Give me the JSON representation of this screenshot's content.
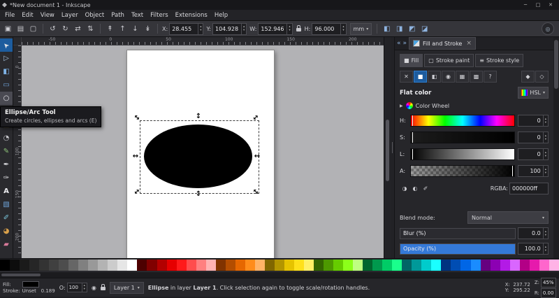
{
  "titlebar": {
    "title": "*New document 1 - Inkscape",
    "minimize": "─",
    "maximize": "□",
    "close": "✕"
  },
  "menubar": {
    "items": [
      "File",
      "Edit",
      "View",
      "Layer",
      "Object",
      "Path",
      "Text",
      "Filters",
      "Extensions",
      "Help"
    ]
  },
  "toolbar": {
    "select_icons": [
      {
        "name": "select-all-icon",
        "glyph": "▣"
      },
      {
        "name": "select-all-layers-icon",
        "glyph": "▤"
      },
      {
        "name": "deselect-icon",
        "glyph": "▢"
      }
    ],
    "transform_icons": [
      {
        "name": "rotate-ccw-icon",
        "glyph": "↺"
      },
      {
        "name": "rotate-cw-icon",
        "glyph": "↻"
      },
      {
        "name": "flip-horizontal-icon",
        "glyph": "⇄"
      },
      {
        "name": "flip-vertical-icon",
        "glyph": "⇅"
      }
    ],
    "order_icons": [
      {
        "name": "raise-to-top-icon",
        "glyph": "↟"
      },
      {
        "name": "raise-icon",
        "glyph": "↑"
      },
      {
        "name": "lower-icon",
        "glyph": "↓"
      },
      {
        "name": "lower-to-bottom-icon",
        "glyph": "↡"
      }
    ],
    "toggle_icons": [
      {
        "name": "scale-stroke-toggle-icon",
        "glyph": "◧",
        "cls": "blue"
      },
      {
        "name": "scale-corners-toggle-icon",
        "glyph": "◨",
        "cls": "blue"
      },
      {
        "name": "move-gradients-toggle-icon",
        "glyph": "◩",
        "cls": "blue"
      },
      {
        "name": "move-patterns-toggle-icon",
        "glyph": "◪",
        "cls": "blue"
      }
    ],
    "snap_icon": "◎",
    "x_label": "X:",
    "x_value": "28.455",
    "y_label": "Y:",
    "y_value": "104.928",
    "w_label": "W:",
    "w_value": "152.946",
    "h_label": "H:",
    "h_value": "96.000",
    "unit": "mm"
  },
  "ui": {
    "caret": "▾",
    "stepper_up": "▴",
    "stepper_down": "▾",
    "expander": "▶"
  },
  "toolbox": {
    "tools": [
      {
        "name": "selector-tool-icon",
        "glyph": "➤",
        "color": "#e2e2e6",
        "cls": "active tool-selector"
      },
      {
        "name": "node-tool-icon",
        "glyph": "▷",
        "color": "#a8c4e0"
      },
      {
        "name": "shape-builder-tool-icon",
        "glyph": "◧",
        "color": "#7fb2e5"
      },
      {
        "name": "rectangle-tool-icon",
        "glyph": "▭",
        "color": "#6fa3d8"
      },
      {
        "name": "ellipse-tool-icon",
        "glyph": "○",
        "color": "#e8e8ec",
        "cls": "hover"
      },
      {
        "name": "star-tool-icon",
        "glyph": "★",
        "color": "#e3c24a"
      },
      {
        "name": "box3d-tool-icon",
        "glyph": "◫",
        "color": "#c9a45a"
      },
      {
        "name": "spiral-tool-icon",
        "glyph": "◔",
        "color": "#c9c9ce"
      },
      {
        "name": "pencil-tool-icon",
        "glyph": "✎",
        "color": "#8fc47a"
      },
      {
        "name": "pen-tool-icon",
        "glyph": "✒",
        "color": "#d8d8dc"
      },
      {
        "name": "calligraphy-tool-icon",
        "glyph": "✑",
        "color": "#d8d8dc"
      },
      {
        "name": "text-tool-icon",
        "glyph": "A",
        "color": "#ececf0",
        "cls": "tool-text"
      },
      {
        "name": "gradient-tool-icon",
        "glyph": "▧",
        "color": "#6fa3d8"
      },
      {
        "name": "dropper-tool-icon",
        "glyph": "✐",
        "color": "#7ac4da"
      },
      {
        "name": "bucket-fill-tool-icon",
        "glyph": "◕",
        "color": "#d8a04a"
      },
      {
        "name": "eraser-tool-icon",
        "glyph": "▰",
        "color": "#d87a9a"
      }
    ]
  },
  "canvas": {
    "ruler_top": [
      "-50",
      "0",
      "50",
      "100",
      "150",
      "200"
    ],
    "ruler_left": [
      "0",
      "50",
      "100",
      "150",
      "200"
    ],
    "handle_h": "↔",
    "handle_v": "↕",
    "object_fill": "#000000"
  },
  "tooltip": {
    "title": "Ellipse/Arc Tool",
    "description": "Create circles, ellipses and arcs (E)"
  },
  "side_panel": {
    "header": {
      "collapse_icon": "«",
      "float_icon": "»",
      "tab_label": "Fill and Stroke",
      "close_icon": "×"
    },
    "fs_tabs": [
      {
        "name": "tab-fill",
        "glyph": "■",
        "label": "Fill",
        "cls": "active"
      },
      {
        "name": "tab-stroke-paint",
        "glyph": "▢",
        "label": "Stroke paint"
      },
      {
        "name": "tab-stroke-style",
        "glyph": "≡",
        "label": "Stroke style"
      }
    ],
    "paint_types": [
      {
        "name": "no-paint-icon",
        "glyph": "✕"
      },
      {
        "name": "flat-color-icon",
        "glyph": "■",
        "cls": "active"
      },
      {
        "name": "linear-gradient-icon",
        "glyph": "◧"
      },
      {
        "name": "radial-gradient-icon",
        "glyph": "◉"
      },
      {
        "name": "pattern-icon",
        "glyph": "▦"
      },
      {
        "name": "swatch-icon",
        "glyph": "▩"
      },
      {
        "name": "unknown-paint-icon",
        "glyph": "?"
      }
    ],
    "rule_icons": [
      {
        "name": "fill-rule-nonzero-icon",
        "glyph": "◆"
      },
      {
        "name": "fill-rule-evenodd-icon",
        "glyph": "◇"
      }
    ],
    "flat_label": "Flat color",
    "mode_value": "HSL",
    "wheel_label": "Color Wheel",
    "sliders": {
      "h": {
        "label": "H:",
        "value": "0"
      },
      "s": {
        "label": "S:",
        "value": "0"
      },
      "l": {
        "label": "L:",
        "value": "0"
      },
      "a": {
        "label": "A:",
        "value": "100"
      }
    },
    "rgba_icons": [
      {
        "name": "cms-icon",
        "glyph": "◑"
      },
      {
        "name": "wheel-toggle-icon",
        "glyph": "◐"
      },
      {
        "name": "pick-color-dropper-icon",
        "glyph": "✐"
      }
    ],
    "rgba_label": "RGBA:",
    "rgba_value": "000000ff",
    "blend_label": "Blend mode:",
    "blend_value": "Normal",
    "blur_label": "Blur (%)",
    "blur_value": "0.0",
    "opacity_label": "Opacity (%)",
    "opacity_value": "100.0"
  },
  "palette": {
    "colors": [
      "#000000",
      "#0d0d0d",
      "#1a1a1a",
      "#262626",
      "#333333",
      "#404040",
      "#4d4d4d",
      "#666666",
      "#808080",
      "#999999",
      "#b3b3b3",
      "#cccccc",
      "#e6e6e6",
      "#ffffff",
      "#4d0000",
      "#800000",
      "#b30000",
      "#e60000",
      "#ff1a1a",
      "#ff4d4d",
      "#ff8080",
      "#ffb3b3",
      "#803300",
      "#b34d00",
      "#e66700",
      "#ff8c1a",
      "#ffb366",
      "#806600",
      "#b39500",
      "#e6c300",
      "#ffe01a",
      "#fff066",
      "#336600",
      "#4d9900",
      "#66cc00",
      "#8cff1a",
      "#bfff80",
      "#00662e",
      "#00994d",
      "#00cc66",
      "#1aff8c",
      "#006666",
      "#009999",
      "#00cccc",
      "#1affff",
      "#003380",
      "#004db3",
      "#0066e6",
      "#1a8cff",
      "#660080",
      "#8c00b3",
      "#b31ae6",
      "#d966ff",
      "#b30086",
      "#e61aac",
      "#ff66cc",
      "#ffb3e6"
    ]
  },
  "statusbar": {
    "fill_label": "Fill:",
    "fill_color": "#000000",
    "stroke_label": "Stroke:",
    "stroke_value": "Unset",
    "stroke_width": "0.189",
    "opacity_label": "O:",
    "opacity_value": "100",
    "layer_name": "Layer 1",
    "message_parts": [
      {
        "t": "Ellipse",
        "cls": "bold"
      },
      {
        "t": " in layer "
      },
      {
        "t": "Layer 1",
        "cls": "bold"
      },
      {
        "t": ". Click selection again to toggle scale/rotation handles."
      }
    ],
    "x_label": "X:",
    "x_value": "237.72",
    "y_label": "Y:",
    "y_value": "295.22",
    "z_label": "Z:",
    "z_value": "45%",
    "r_label": "R:",
    "r_value": "0.00"
  }
}
